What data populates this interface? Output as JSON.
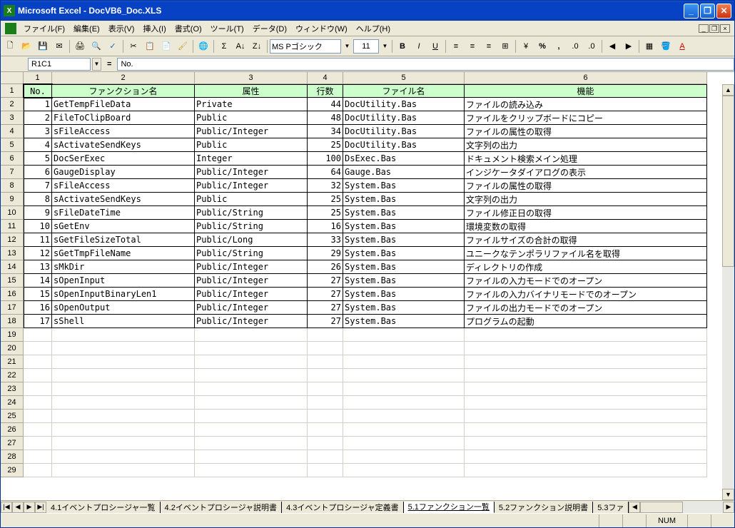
{
  "title": "Microsoft Excel - DocVB6_Doc.XLS",
  "menu": {
    "file": "ファイル(F)",
    "edit": "編集(E)",
    "view": "表示(V)",
    "insert": "挿入(I)",
    "format": "書式(O)",
    "tools": "ツール(T)",
    "data": "データ(D)",
    "window": "ウィンドウ(W)",
    "help": "ヘルプ(H)"
  },
  "toolbar": {
    "font": "MS Pゴシック",
    "size": "11"
  },
  "formula": {
    "ref": "R1C1",
    "value": "No."
  },
  "cols": [
    "",
    "1",
    "2",
    "3",
    "4",
    "5",
    "6"
  ],
  "headers": {
    "c1": "No.",
    "c2": "ファンクション名",
    "c3": "属性",
    "c4": "行数",
    "c5": "ファイル名",
    "c6": "機能"
  },
  "rows": [
    {
      "n": "1",
      "f": "GetTempFileData",
      "a": "Private",
      "l": "44",
      "fi": "DocUtility.Bas",
      "d": "ファイルの読み込み"
    },
    {
      "n": "2",
      "f": "FileToClipBoard",
      "a": "Public",
      "l": "48",
      "fi": "DocUtility.Bas",
      "d": "ファイルをクリップボードにコピー"
    },
    {
      "n": "3",
      "f": "sFileAccess",
      "a": "Public/Integer",
      "l": "34",
      "fi": "DocUtility.Bas",
      "d": "ファイルの属性の取得"
    },
    {
      "n": "4",
      "f": "sActivateSendKeys",
      "a": "Public",
      "l": "25",
      "fi": "DocUtility.Bas",
      "d": "文字列の出力"
    },
    {
      "n": "5",
      "f": "DocSerExec",
      "a": "Integer",
      "l": "100",
      "fi": "DsExec.Bas",
      "d": "ドキュメント検索メイン処理"
    },
    {
      "n": "6",
      "f": "GaugeDisplay",
      "a": "Public/Integer",
      "l": "64",
      "fi": "Gauge.Bas",
      "d": "インジケータダイアログの表示"
    },
    {
      "n": "7",
      "f": "sFileAccess",
      "a": "Public/Integer",
      "l": "32",
      "fi": "System.Bas",
      "d": "ファイルの属性の取得"
    },
    {
      "n": "8",
      "f": "sActivateSendKeys",
      "a": "Public",
      "l": "25",
      "fi": "System.Bas",
      "d": "文字列の出力"
    },
    {
      "n": "9",
      "f": "sFileDateTime",
      "a": "Public/String",
      "l": "25",
      "fi": "System.Bas",
      "d": "ファイル修正日の取得"
    },
    {
      "n": "10",
      "f": "sGetEnv",
      "a": "Public/String",
      "l": "16",
      "fi": "System.Bas",
      "d": "環境変数の取得"
    },
    {
      "n": "11",
      "f": "sGetFileSizeTotal",
      "a": "Public/Long",
      "l": "33",
      "fi": "System.Bas",
      "d": "ファイルサイズの合計の取得"
    },
    {
      "n": "12",
      "f": "sGetTmpFileName",
      "a": "Public/String",
      "l": "29",
      "fi": "System.Bas",
      "d": "ユニークなテンポラリファイル名を取得"
    },
    {
      "n": "13",
      "f": "sMkDir",
      "a": "Public/Integer",
      "l": "26",
      "fi": "System.Bas",
      "d": "ディレクトリの作成"
    },
    {
      "n": "14",
      "f": "sOpenInput",
      "a": "Public/Integer",
      "l": "27",
      "fi": "System.Bas",
      "d": "ファイルの入力モードでのオープン"
    },
    {
      "n": "15",
      "f": "sOpenInputBinaryLen1",
      "a": "Public/Integer",
      "l": "27",
      "fi": "System.Bas",
      "d": "ファイルの入力バイナリモードでのオープン"
    },
    {
      "n": "16",
      "f": "sOpenOutput",
      "a": "Public/Integer",
      "l": "27",
      "fi": "System.Bas",
      "d": "ファイルの出力モードでのオープン"
    },
    {
      "n": "17",
      "f": "sShell",
      "a": "Public/Integer",
      "l": "27",
      "fi": "System.Bas",
      "d": "プログラムの起動"
    }
  ],
  "empty_rows": [
    "19",
    "20",
    "21",
    "22",
    "23",
    "24",
    "25",
    "26",
    "27",
    "28",
    "29"
  ],
  "tabs": {
    "t1": "4.1イベントプロシージャ一覧",
    "t2": "4.2イベントプロシージャ説明書",
    "t3": "4.3イベントプロシージャ定義書",
    "t4": "5.1ファンクション一覧",
    "t5": "5.2ファンクション説明書",
    "t6": "5.3ファ"
  },
  "status": {
    "num": "NUM"
  }
}
